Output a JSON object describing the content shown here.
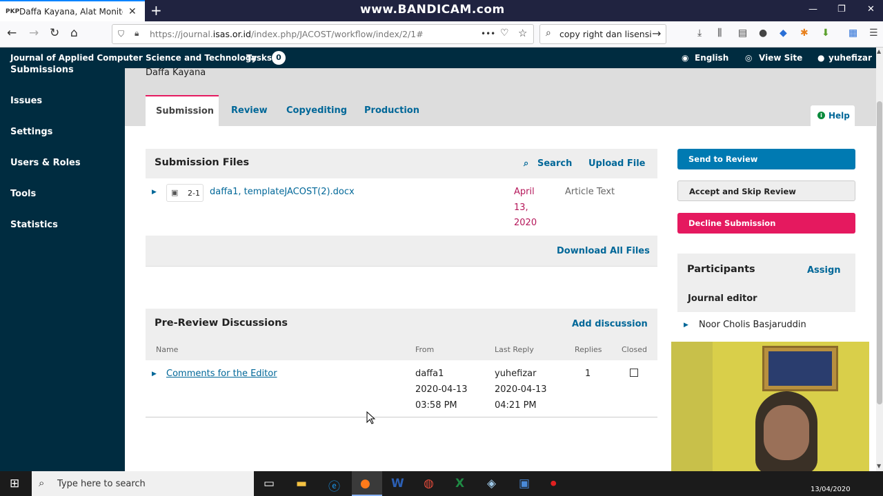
{
  "browser": {
    "tab_icon": "PKP",
    "tab_title": "Daffa Kayana, Alat Monitoring",
    "tab_close": "✕",
    "new_tab": "+",
    "watermark": "www.BANDICAM.com",
    "url_prefix": "https://journal.",
    "url_domain": "isas.or.id",
    "url_path": "/index.php/JACOST/workflow/index/2/1#",
    "url_more": "•••",
    "search_query": "copy right dan lisensi",
    "search_go": "→"
  },
  "header": {
    "journal_title": "Journal of Applied Computer Science and Technology",
    "tasks_label": "Tasks",
    "tasks_count": "0",
    "language": "English",
    "view_site": "View Site",
    "username": "yuhefizar"
  },
  "sidebar": {
    "items": [
      {
        "label": "Submissions"
      },
      {
        "label": "Issues"
      },
      {
        "label": "Settings"
      },
      {
        "label": "Users & Roles"
      },
      {
        "label": "Tools"
      },
      {
        "label": "Statistics"
      }
    ]
  },
  "submission": {
    "author": "Daffa Kayana",
    "tabs": [
      {
        "label": "Submission"
      },
      {
        "label": "Review"
      },
      {
        "label": "Copyediting"
      },
      {
        "label": "Production"
      }
    ],
    "help_label": "Help"
  },
  "files": {
    "title": "Submission Files",
    "search_label": "Search",
    "upload_label": "Upload File",
    "file_id": "2-1",
    "file_name": "daffa1, templateJACOST(2).docx",
    "date_l1": "April",
    "date_l2": "13,",
    "date_l3": "2020",
    "file_type": "Article Text",
    "download_all": "Download All Files"
  },
  "discussions": {
    "title": "Pre-Review Discussions",
    "add_label": "Add discussion",
    "columns": [
      "Name",
      "From",
      "Last Reply",
      "Replies",
      "Closed"
    ],
    "row": {
      "name": "Comments for the Editor",
      "from_user": "daffa1",
      "from_date": "2020-04-13",
      "from_time": "03:58 PM",
      "reply_user": "yuhefizar",
      "reply_date": "2020-04-13",
      "reply_time": "04:21 PM",
      "replies": "1"
    }
  },
  "actions": {
    "send_to_review": "Send to Review",
    "accept_skip": "Accept and Skip Review",
    "decline": "Decline Submission"
  },
  "participants": {
    "title": "Participants",
    "assign_label": "Assign",
    "role": "Journal editor",
    "name": "Noor Cholis Basjaruddin"
  },
  "taskbar": {
    "search_placeholder": "Type here to search",
    "date": "13/04/2020"
  },
  "colors": {
    "ojs_navy": "#002c40",
    "link_blue": "#006798",
    "primary_blue": "#007ab2",
    "decline_pink": "#e5195f",
    "date_pink": "#b5175a"
  }
}
